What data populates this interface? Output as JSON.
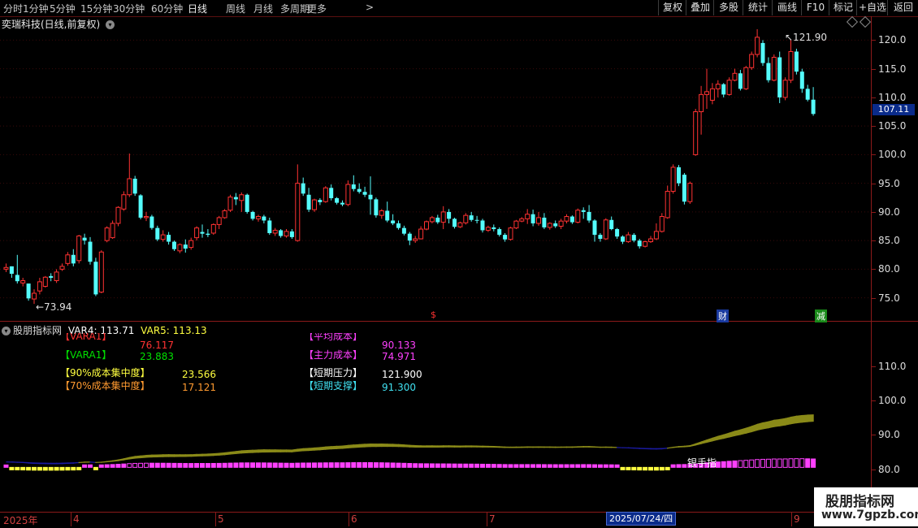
{
  "toolbar": {
    "periods": [
      "分时",
      "1分钟",
      "5分钟",
      "15分钟",
      "30分钟",
      "60分钟",
      "日线",
      "周线",
      "月线",
      "多周期",
      "更多"
    ],
    "active_period": "日线",
    "more_arrow": ">",
    "right_buttons": [
      "复权",
      "叠加",
      "多股",
      "统计",
      "画线",
      "F10",
      "标记",
      "+自选",
      "返回"
    ]
  },
  "main_chart": {
    "title": "奕瑞科技(日线,前复权)",
    "y_ticks": [
      "120.0",
      "115.0",
      "110.0",
      "105.0",
      "100.0",
      "95.0",
      "90.0",
      "85.0",
      "80.0",
      "75.0"
    ],
    "current_price_tag": "107.11",
    "high_label": "121.90",
    "low_label": "73.94",
    "event_marks": [
      "$",
      "财",
      "减"
    ],
    "colors": {
      "up": "#ff3232",
      "down": "#54fcfc",
      "axis": "#8b1a1a",
      "price_tag_bg": "#0a2b8a"
    }
  },
  "sub_chart": {
    "title": "股朋指标网",
    "var4_label": "VAR4:",
    "var4": "113.71",
    "var5_label": "VAR5:",
    "var5": "113.13",
    "rows": [
      {
        "name": "【VARA1】",
        "value": "76.117",
        "name_color": "#ff3232",
        "value_color": "#ff3232"
      },
      {
        "name": "【VARA1】",
        "value": "23.883",
        "name_color": "#00e000",
        "value_color": "#00e000"
      },
      {
        "name": "【90%成本集中度】",
        "value": "23.566",
        "name_color": "#ffff40",
        "value_color": "#ffff40"
      },
      {
        "name": "【70%成本集中度】",
        "value": "17.121",
        "name_color": "#ff9a30",
        "value_color": "#ff9a30"
      }
    ],
    "rows_right": [
      {
        "name": "【平均成本】",
        "value": "90.133",
        "name_color": "#ff40ff",
        "value_color": "#ff40ff"
      },
      {
        "name": "【主力成本】",
        "value": "74.971",
        "name_color": "#ff40ff",
        "value_color": "#ff40ff"
      },
      {
        "name": "【短期压力】",
        "value": "121.900",
        "name_color": "#ffffff",
        "value_color": "#ffffff"
      },
      {
        "name": "【短期支撑】",
        "value": "91.300",
        "name_color": "#40e0f0",
        "value_color": "#40e0f0"
      }
    ],
    "y_ticks": [
      "110.0",
      "100.0",
      "90.0",
      "80.0"
    ],
    "signal_label": "银手指",
    "colors": {
      "band": "#8a8a18",
      "band_low": "#1a1aa0",
      "pos_bar": "#ff40ff",
      "neg_bar": "#ffff40"
    }
  },
  "date_axis": {
    "labels": [
      "2025年",
      "4",
      "5",
      "6",
      "7",
      "9"
    ],
    "crosshair_date": "2025/07/24/四"
  },
  "watermark": {
    "name": "股朋指标网",
    "url": "www.7gpzb.com"
  },
  "chart_data": {
    "type": "candlestick",
    "title": "奕瑞科技(日线,前复权)",
    "ylim": [
      72,
      123
    ],
    "candles": [
      [
        80.0,
        81.0,
        80.3,
        79.5
      ],
      [
        80.5,
        80.5,
        79.2,
        78.5
      ],
      [
        79.0,
        82.5,
        77.9,
        77.5
      ],
      [
        77.6,
        78.5,
        78.0,
        77.0
      ],
      [
        77.5,
        77.5,
        74.9,
        74.5
      ],
      [
        74.8,
        76.5,
        75.8,
        73.94
      ],
      [
        76.2,
        78.5,
        77.8,
        75.6
      ],
      [
        77.0,
        78.8,
        78.6,
        76.8
      ],
      [
        78.8,
        79.3,
        78.5,
        77.9
      ],
      [
        78.0,
        80.0,
        79.5,
        77.6
      ],
      [
        80.0,
        81.0,
        80.5,
        79.7
      ],
      [
        81.0,
        83.0,
        82.5,
        80.6
      ],
      [
        82.5,
        83.5,
        81.0,
        80.5
      ],
      [
        81.5,
        86.0,
        85.8,
        81.0
      ],
      [
        85.5,
        86.2,
        85.0,
        84.3
      ],
      [
        84.8,
        85.6,
        81.3,
        80.8
      ],
      [
        81.3,
        82.0,
        75.6,
        75.3
      ],
      [
        76.0,
        83.3,
        83.0,
        75.8
      ],
      [
        85.0,
        87.5,
        87.2,
        84.7
      ],
      [
        85.5,
        88.5,
        88.0,
        85.3
      ],
      [
        88.0,
        91.0,
        90.8,
        87.5
      ],
      [
        90.5,
        93.6,
        93.0,
        90.2
      ],
      [
        93.0,
        100.2,
        95.8,
        92.6
      ],
      [
        95.8,
        96.3,
        93.2,
        92.8
      ],
      [
        92.9,
        93.1,
        89.0,
        88.7
      ],
      [
        89.0,
        90.0,
        89.2,
        88.4
      ],
      [
        89.2,
        89.5,
        87.2,
        86.9
      ],
      [
        87.2,
        87.6,
        85.2,
        84.9
      ],
      [
        85.2,
        86.8,
        86.0,
        84.8
      ],
      [
        86.0,
        86.5,
        84.8,
        84.3
      ],
      [
        84.8,
        85.0,
        83.5,
        83.2
      ],
      [
        83.2,
        84.5,
        84.3,
        82.8
      ],
      [
        84.3,
        85.2,
        83.6,
        82.9
      ],
      [
        83.8,
        85.5,
        85.0,
        83.4
      ],
      [
        85.5,
        87.5,
        87.2,
        85.0
      ],
      [
        86.5,
        87.8,
        86.2,
        85.5
      ],
      [
        86.2,
        87.0,
        86.0,
        85.6
      ],
      [
        86.3,
        88.0,
        87.8,
        86.0
      ],
      [
        87.8,
        89.3,
        89.0,
        87.0
      ],
      [
        89.0,
        90.5,
        90.2,
        88.8
      ],
      [
        90.3,
        93.0,
        92.6,
        90.0
      ],
      [
        92.6,
        93.3,
        92.2,
        91.2
      ],
      [
        92.0,
        93.4,
        93.0,
        90.0
      ],
      [
        93.0,
        93.2,
        90.0,
        89.7
      ],
      [
        90.0,
        90.2,
        88.8,
        88.5
      ],
      [
        88.8,
        89.5,
        89.2,
        88.3
      ],
      [
        89.2,
        89.5,
        88.5,
        88.0
      ],
      [
        88.5,
        89.0,
        86.3,
        86.0
      ],
      [
        86.3,
        87.2,
        86.8,
        85.8
      ],
      [
        86.8,
        87.0,
        85.8,
        85.5
      ],
      [
        85.8,
        87.0,
        86.6,
        85.5
      ],
      [
        86.6,
        87.0,
        85.6,
        85.3
      ],
      [
        85.0,
        98.3,
        95.0,
        84.8
      ],
      [
        95.0,
        96.0,
        93.2,
        92.8
      ],
      [
        93.0,
        94.2,
        90.4,
        90.0
      ],
      [
        90.4,
        92.3,
        92.1,
        90.0
      ],
      [
        92.1,
        92.4,
        91.7,
        91.2
      ],
      [
        91.8,
        94.5,
        94.2,
        91.6
      ],
      [
        94.2,
        94.8,
        92.4,
        92.0
      ],
      [
        92.4,
        92.6,
        91.6,
        91.3
      ],
      [
        91.6,
        92.0,
        91.3,
        91.0
      ],
      [
        91.3,
        95.5,
        94.8,
        91.0
      ],
      [
        94.8,
        96.4,
        94.0,
        93.6
      ],
      [
        94.0,
        95.0,
        93.5,
        93.2
      ],
      [
        93.5,
        94.4,
        93.0,
        92.6
      ],
      [
        93.0,
        96.2,
        92.2,
        89.5
      ],
      [
        92.2,
        92.5,
        89.4,
        89.0
      ],
      [
        89.4,
        90.5,
        90.2,
        88.8
      ],
      [
        90.2,
        91.8,
        88.5,
        88.2
      ],
      [
        88.5,
        89.6,
        88.0,
        87.7
      ],
      [
        88.0,
        88.5,
        87.2,
        86.9
      ],
      [
        87.2,
        87.6,
        86.2,
        85.9
      ],
      [
        86.2,
        86.5,
        85.0,
        84.2
      ],
      [
        85.0,
        85.8,
        85.3,
        84.6
      ],
      [
        85.3,
        87.5,
        87.0,
        85.2
      ],
      [
        87.0,
        88.5,
        88.3,
        86.8
      ],
      [
        88.3,
        89.3,
        89.0,
        88.0
      ],
      [
        89.0,
        89.5,
        88.2,
        87.9
      ],
      [
        88.2,
        91.0,
        90.0,
        87.0
      ],
      [
        90.0,
        90.5,
        88.8,
        88.0
      ],
      [
        88.8,
        89.0,
        87.4,
        87.1
      ],
      [
        87.4,
        88.3,
        88.1,
        87.2
      ],
      [
        88.1,
        89.8,
        89.4,
        87.8
      ],
      [
        89.4,
        90.0,
        88.6,
        88.3
      ],
      [
        88.6,
        89.3,
        88.5,
        88.0
      ],
      [
        88.5,
        88.8,
        86.8,
        86.4
      ],
      [
        86.8,
        87.6,
        87.3,
        86.5
      ],
      [
        87.3,
        87.8,
        87.0,
        86.6
      ],
      [
        87.0,
        87.3,
        86.0,
        85.7
      ],
      [
        86.0,
        86.3,
        85.2,
        84.8
      ],
      [
        85.2,
        87.4,
        87.2,
        85.0
      ],
      [
        87.2,
        88.6,
        88.4,
        87.0
      ],
      [
        88.4,
        89.1,
        88.8,
        88.2
      ],
      [
        88.8,
        90.5,
        89.6,
        87.9
      ],
      [
        89.6,
        90.4,
        88.0,
        87.5
      ],
      [
        88.0,
        90.0,
        89.0,
        87.6
      ],
      [
        89.0,
        89.8,
        87.3,
        87.0
      ],
      [
        87.3,
        88.2,
        88.0,
        86.9
      ],
      [
        88.0,
        88.5,
        87.5,
        87.2
      ],
      [
        87.5,
        88.8,
        88.4,
        87.0
      ],
      [
        88.4,
        89.6,
        89.2,
        88.0
      ],
      [
        89.2,
        89.4,
        88.2,
        87.9
      ],
      [
        88.2,
        90.6,
        90.3,
        88.0
      ],
      [
        90.3,
        90.8,
        90.0,
        88.8
      ],
      [
        90.0,
        91.2,
        88.5,
        88.1
      ],
      [
        88.5,
        88.7,
        86.0,
        84.8
      ],
      [
        86.0,
        86.3,
        85.3,
        84.8
      ],
      [
        85.3,
        88.9,
        88.6,
        85.1
      ],
      [
        88.6,
        89.2,
        87.0,
        86.8
      ],
      [
        87.0,
        87.2,
        85.7,
        85.3
      ],
      [
        85.7,
        85.9,
        84.8,
        84.4
      ],
      [
        84.8,
        86.5,
        86.0,
        84.6
      ],
      [
        86.0,
        86.3,
        85.0,
        84.7
      ],
      [
        85.0,
        85.3,
        84.0,
        83.6
      ],
      [
        84.0,
        85.0,
        84.8,
        83.8
      ],
      [
        84.8,
        85.8,
        85.3,
        84.6
      ],
      [
        85.3,
        88.0,
        86.6,
        85.1
      ],
      [
        86.6,
        89.8,
        89.2,
        86.4
      ],
      [
        89.0,
        94.6,
        93.6,
        88.8
      ],
      [
        93.6,
        98.3,
        97.8,
        93.2
      ],
      [
        97.8,
        98.2,
        95.0,
        94.5
      ],
      [
        96.5,
        96.8,
        91.8,
        91.3
      ],
      [
        91.8,
        95.3,
        95.0,
        91.4
      ],
      [
        100.0,
        108.0,
        107.5,
        99.8
      ],
      [
        107.5,
        112.0,
        110.5,
        103.5
      ],
      [
        110.5,
        115.0,
        111.0,
        108.0
      ],
      [
        109.5,
        112.5,
        111.5,
        108.8
      ],
      [
        111.5,
        113.0,
        112.3,
        110.0
      ],
      [
        112.3,
        112.5,
        110.5,
        110.0
      ],
      [
        110.5,
        113.5,
        113.0,
        110.3
      ],
      [
        113.0,
        115.0,
        114.2,
        112.8
      ],
      [
        114.2,
        114.8,
        111.5,
        111.2
      ],
      [
        111.5,
        115.5,
        115.2,
        111.3
      ],
      [
        115.2,
        118.0,
        117.5,
        114.8
      ],
      [
        117.5,
        121.9,
        120.5,
        117.0
      ],
      [
        119.5,
        120.0,
        116.0,
        115.5
      ],
      [
        116.0,
        117.0,
        113.0,
        112.6
      ],
      [
        113.0,
        117.5,
        117.0,
        112.8
      ],
      [
        117.0,
        118.0,
        110.0,
        109.0
      ],
      [
        110.0,
        113.5,
        113.0,
        109.5
      ],
      [
        113.0,
        120.0,
        118.0,
        112.5
      ],
      [
        118.0,
        118.5,
        114.5,
        114.0
      ],
      [
        114.5,
        115.0,
        111.5,
        110.8
      ],
      [
        111.5,
        112.2,
        109.6,
        109.3
      ],
      [
        109.6,
        111.8,
        107.11,
        106.8
      ]
    ]
  }
}
